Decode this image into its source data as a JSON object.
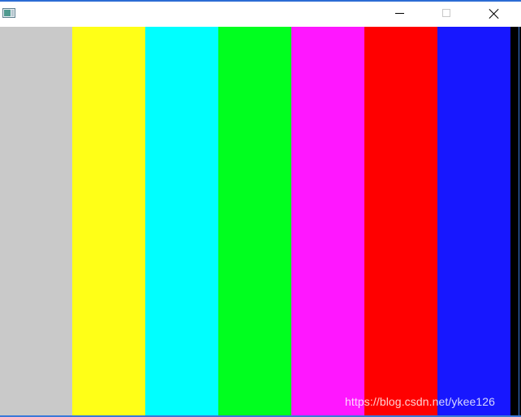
{
  "window": {
    "title": "",
    "controls": {
      "minimize": "minimize-icon",
      "maximize": "maximize-icon",
      "close": "close-icon"
    }
  },
  "color_bars": [
    {
      "name": "gray",
      "color": "#c9c9c9"
    },
    {
      "name": "yellow",
      "color": "#ffff17"
    },
    {
      "name": "cyan",
      "color": "#00ffff"
    },
    {
      "name": "green",
      "color": "#00ff1f"
    },
    {
      "name": "magenta",
      "color": "#ff17ff"
    },
    {
      "name": "red",
      "color": "#ff0000"
    },
    {
      "name": "blue",
      "color": "#1717ff"
    }
  ],
  "watermark": {
    "text": "https://blog.csdn.net/ykee126"
  }
}
